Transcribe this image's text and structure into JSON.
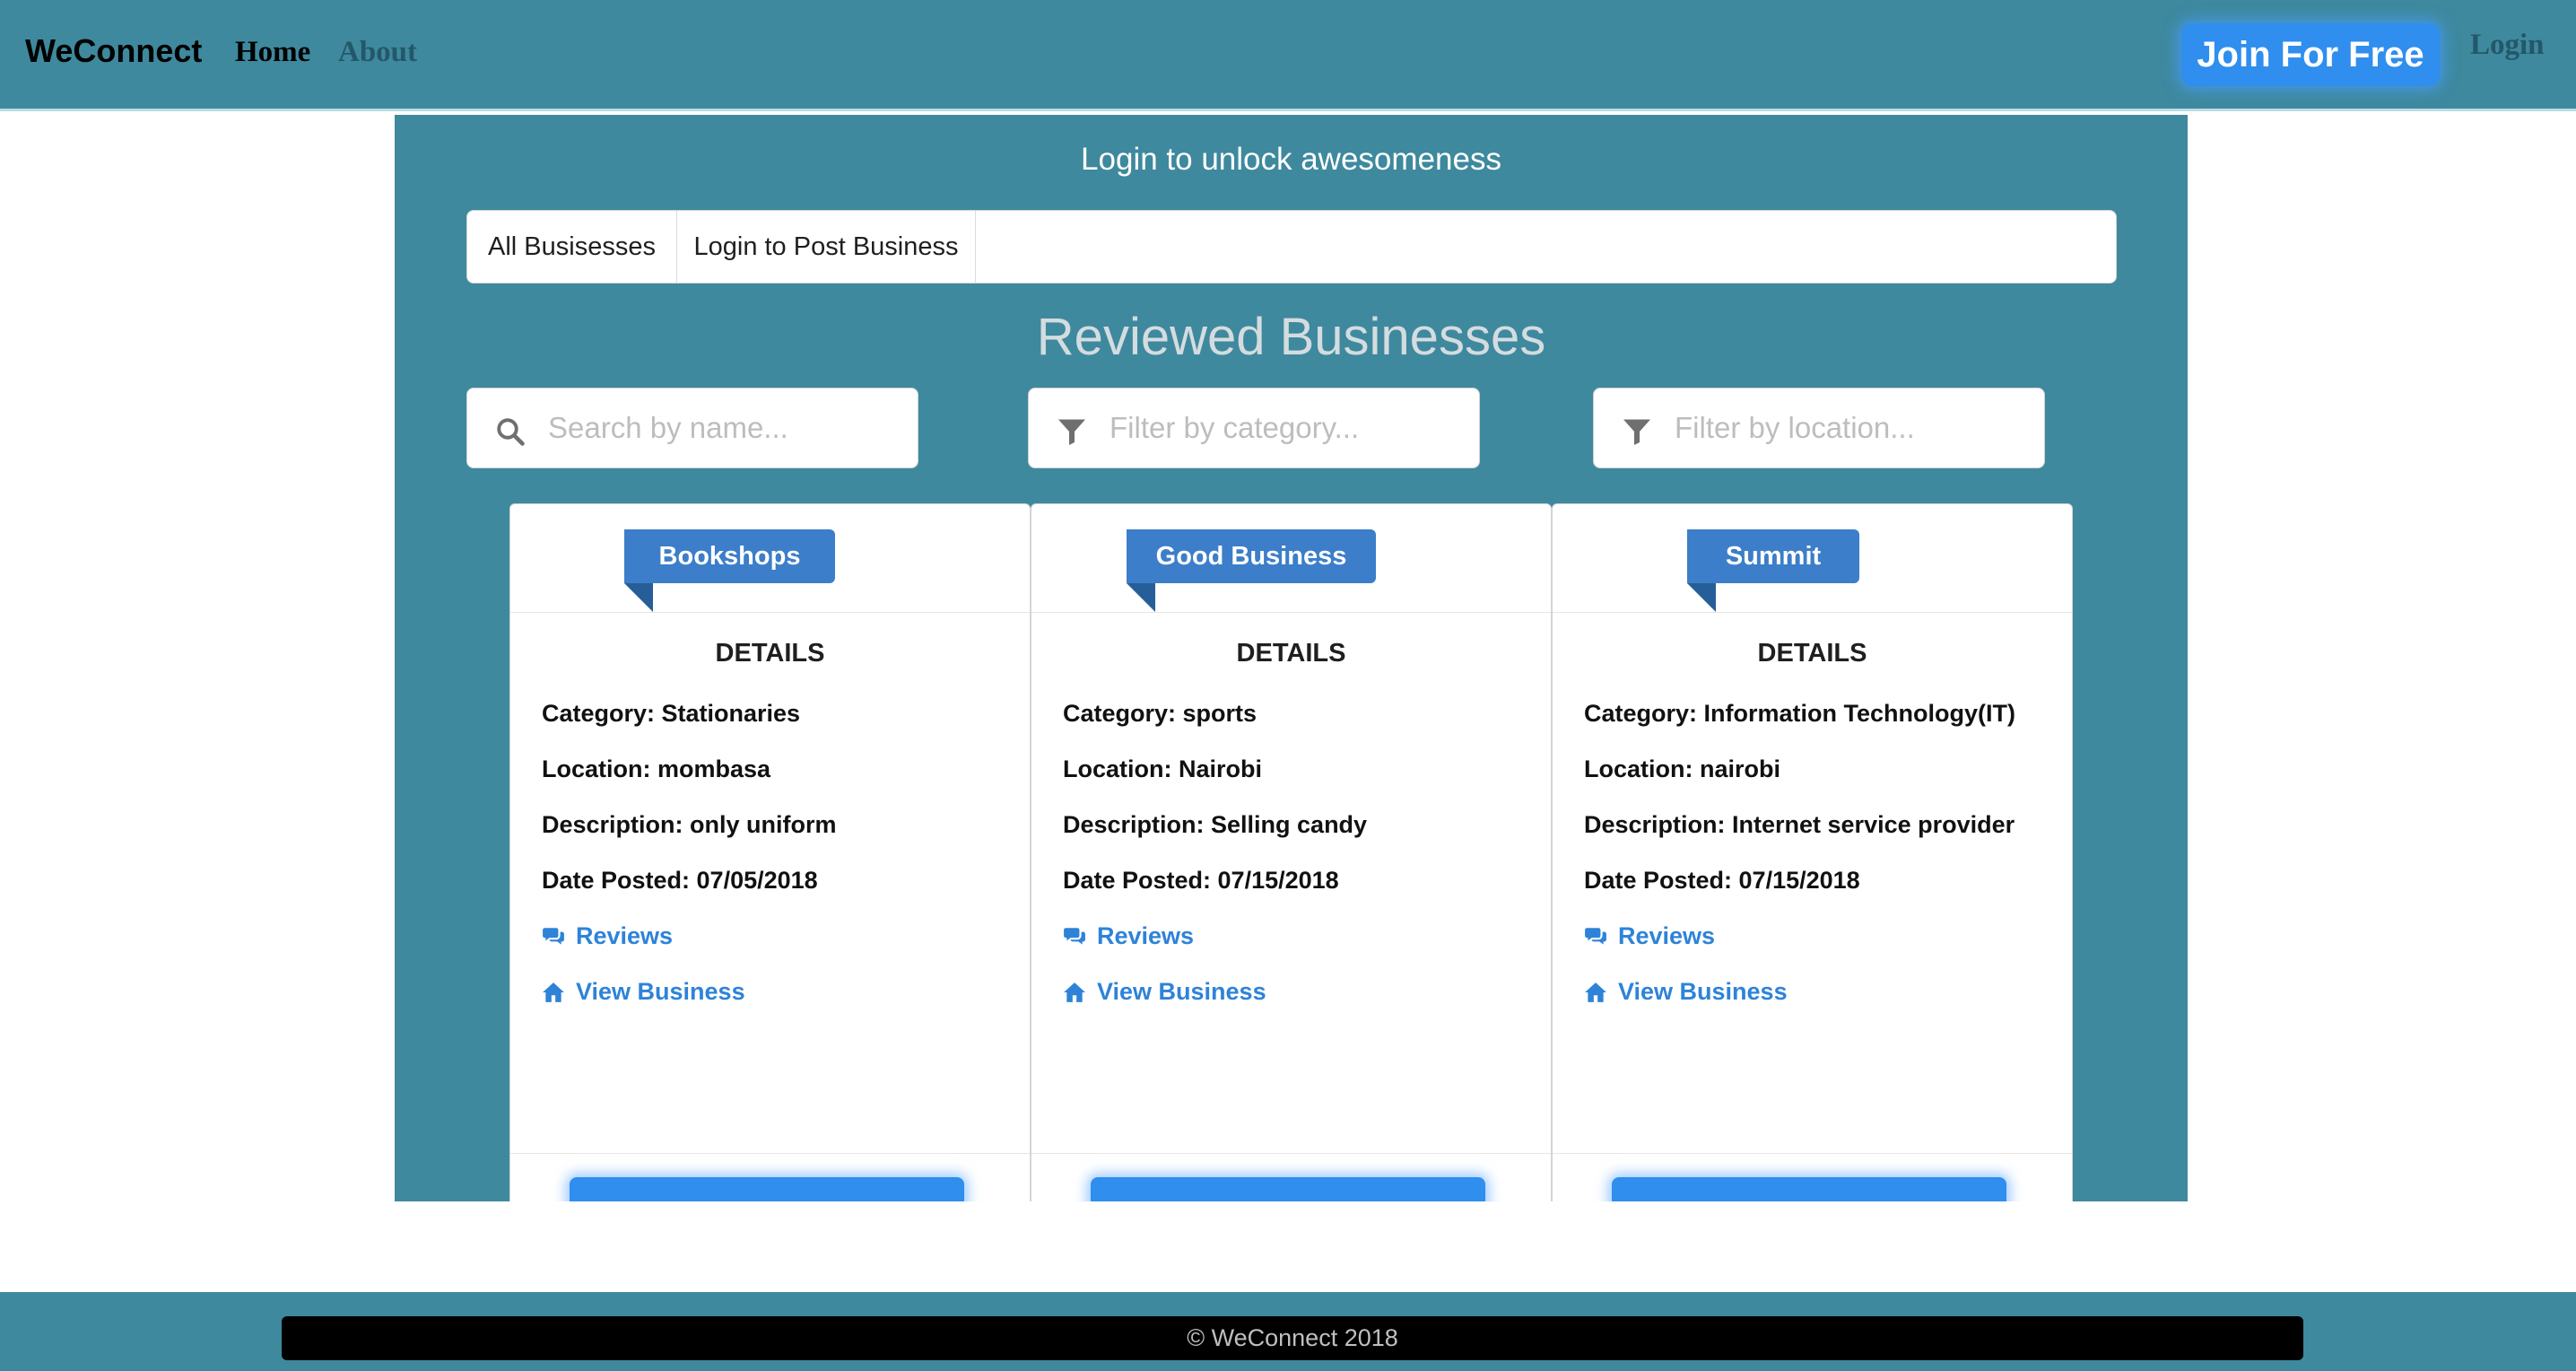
{
  "navbar": {
    "brand": "WeConnect",
    "links": [
      "Home",
      "About"
    ],
    "join_label": "Join For Free",
    "login_label": "Login"
  },
  "panel": {
    "subtitle": "Login to unlock awesomeness",
    "menu": [
      "All Busisesses",
      "Login to Post Business"
    ],
    "section_title": "Reviewed Businesses"
  },
  "filters": {
    "search_placeholder": "Search by name...",
    "category_placeholder": "Filter by category...",
    "location_placeholder": "Filter by location...",
    "search_icon": "search-icon",
    "filter_icon": "filter-icon"
  },
  "cards": [
    {
      "name": "Bookshops",
      "details_label": "DETAILS",
      "category": "Category: Stationaries",
      "location": "Location: mombasa",
      "description": "Description: only uniform",
      "date": "Date Posted: 07/05/2018",
      "reviews_label": "Reviews",
      "view_label": "View Business",
      "button_label": ""
    },
    {
      "name": "Good Business",
      "details_label": "DETAILS",
      "category": "Category: sports",
      "location": "Location: Nairobi",
      "description": "Description: Selling candy",
      "date": "Date Posted: 07/15/2018",
      "reviews_label": "Reviews",
      "view_label": "View Business",
      "button_label": ""
    },
    {
      "name": "Summit",
      "details_label": "DETAILS",
      "category": "Category: Information Technology(IT)",
      "location": "Location: nairobi",
      "description": "Description: Internet service provider",
      "date": "Date Posted: 07/15/2018",
      "reviews_label": "Reviews",
      "view_label": "View Business",
      "button_label": ""
    }
  ],
  "icons": {
    "reviews": "comments-icon",
    "view": "home-icon"
  },
  "footer": {
    "copyright": "© WeConnect 2018"
  },
  "colors": {
    "primary_teal": "#3e899e",
    "button_blue": "#2f8eee",
    "ribbon_blue": "#3c7ec9",
    "link_blue": "#2e83d8"
  }
}
